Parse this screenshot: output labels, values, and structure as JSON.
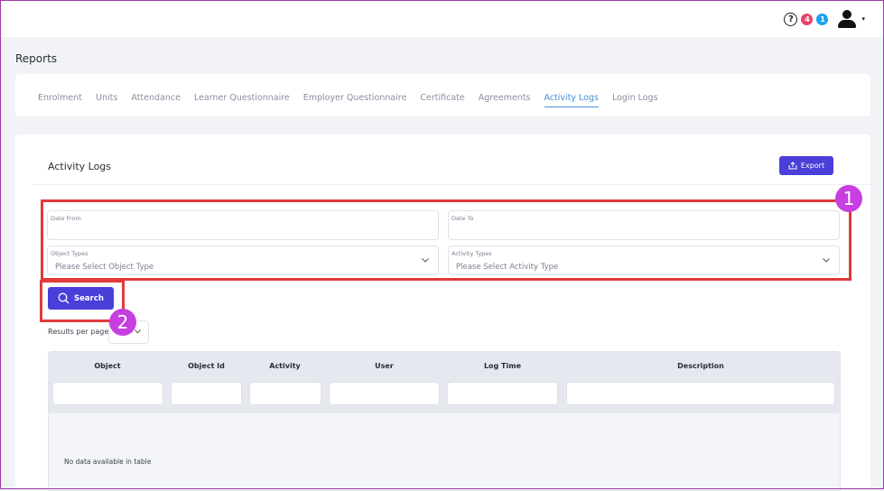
{
  "header": {
    "help_symbol": "?",
    "badge_red": "4",
    "badge_blue": "1",
    "caret": "▾"
  },
  "page": {
    "title": "Reports"
  },
  "tabs": [
    {
      "label": "Enrolment",
      "active": false
    },
    {
      "label": "Units",
      "active": false
    },
    {
      "label": "Attendance",
      "active": false
    },
    {
      "label": "Learner Questionnaire",
      "active": false
    },
    {
      "label": "Employer Questionnaire",
      "active": false
    },
    {
      "label": "Certificate",
      "active": false
    },
    {
      "label": "Agreements",
      "active": false
    },
    {
      "label": "Activity Logs",
      "active": true
    },
    {
      "label": "Login Logs",
      "active": false
    }
  ],
  "section": {
    "title": "Activity Logs",
    "export_label": "Export"
  },
  "filters": {
    "date_from_label": "Date From",
    "date_to_label": "Date To",
    "object_types_label": "Object Types",
    "object_types_placeholder": "Please Select Object Type",
    "activity_types_label": "Activity Types",
    "activity_types_placeholder": "Please Select Activity Type",
    "search_label": "Search"
  },
  "pagination": {
    "results_per_page_label": "Results per page"
  },
  "table": {
    "columns": [
      "Object",
      "Object Id",
      "Activity",
      "User",
      "Log Time",
      "Description"
    ],
    "empty_message": "No data available in table"
  },
  "annotations": {
    "marker1": "1",
    "marker2": "2"
  },
  "colors": {
    "primary_button": "#4a3fd9",
    "active_tab": "#4a90d9",
    "highlight_box": "#e03a3a",
    "step_marker": "#c63fe0",
    "badge_red": "#e9456a",
    "badge_blue": "#1da1f2"
  }
}
